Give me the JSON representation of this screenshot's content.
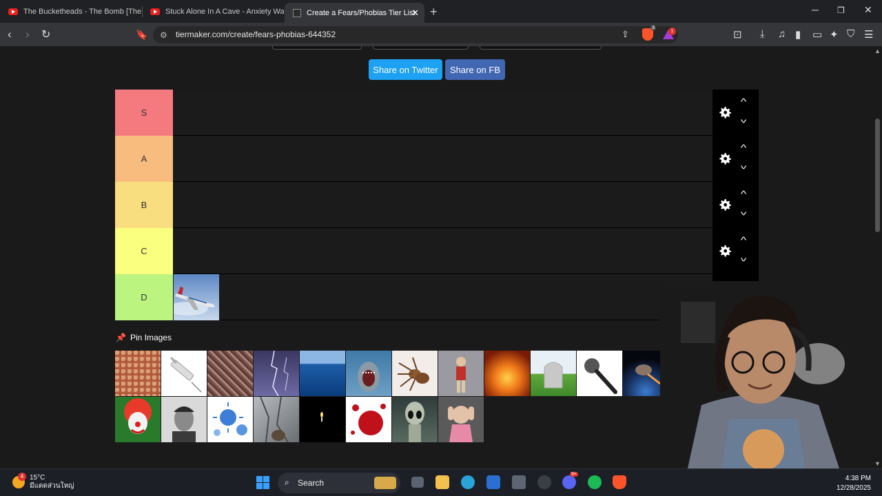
{
  "tabs": [
    {
      "title": "The Bucketheads - The Bomb [These",
      "active": false
    },
    {
      "title": "Stuck Alone In A Cave - Anxiety Warr",
      "active": false
    },
    {
      "title": "Create a Fears/Phobias Tier List",
      "active": true
    }
  ],
  "address": {
    "url": "tiermaker.com/create/fears-phobias-644352",
    "brave_shield_count": "3",
    "rewards_count": "1"
  },
  "share": {
    "twitter": "Share on Twitter",
    "facebook": "Share on FB"
  },
  "tiers": [
    {
      "label": "S",
      "color": "#f47a7f"
    },
    {
      "label": "A",
      "color": "#f8bc7f"
    },
    {
      "label": "B",
      "color": "#f9de7f"
    },
    {
      "label": "C",
      "color": "#fbff7f"
    },
    {
      "label": "D",
      "color": "#bbf57f"
    }
  ],
  "tier_items": {
    "D": [
      "airplane"
    ]
  },
  "pin_images_label": "Pin Images",
  "pool_images": [
    "lotus-seed-pod",
    "syringe",
    "crowd",
    "lightning",
    "ocean",
    "shark",
    "spider",
    "puppet",
    "fire",
    "gravestone",
    "microphone",
    "asteroid",
    "unknown",
    "clown",
    "man-portrait",
    "virus",
    "crack",
    "candle-dark",
    "blood",
    "alien",
    "scared-girl"
  ],
  "taskbar": {
    "weather_temp": "15°C",
    "weather_desc": "มีแดดส่วนใหญ่",
    "weather_badge": "4",
    "search_label": "Search",
    "time": "4:38 PM",
    "date": "12/28/2025",
    "discord_badge": "9+"
  },
  "colors": {
    "twitter": "#1da1f2",
    "facebook": "#4267b2",
    "page_bg": "#1a1a1a"
  }
}
